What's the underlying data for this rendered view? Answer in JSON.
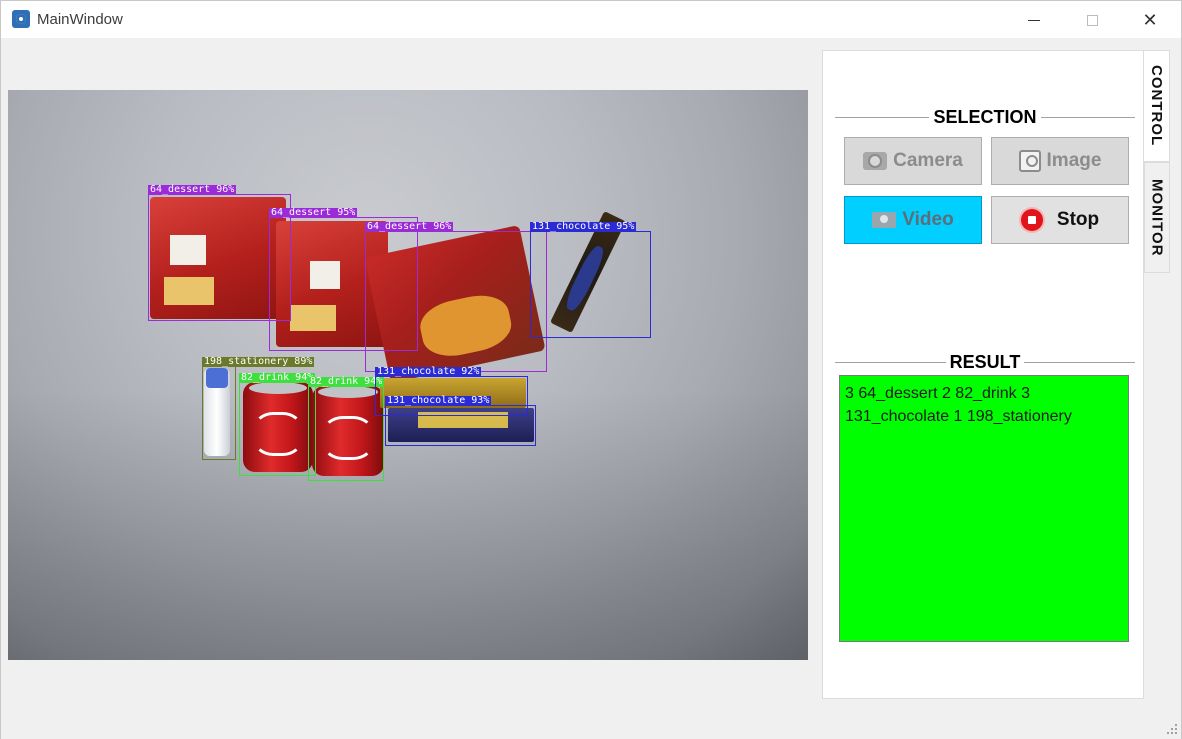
{
  "window": {
    "title": "MainWindow",
    "controls": [
      "minimize",
      "maximize",
      "close"
    ]
  },
  "display": {
    "detections": [
      {
        "label": "64_dessert 96%",
        "color": "#9b2bd6"
      },
      {
        "label": "64_dessert 95%",
        "color": "#9b2bd6"
      },
      {
        "label": "64_dessert 96%",
        "color": "#9b2bd6"
      },
      {
        "label": "131_chocolate 95%",
        "color": "#2b2bd6"
      },
      {
        "label": "198_stationery 89%",
        "color": "#6b7a2a"
      },
      {
        "label": "82_drink 94%",
        "color": "#3ee03e"
      },
      {
        "label": "82_drink 94%",
        "color": "#3ee03e"
      },
      {
        "label": "131_chocolate 92%",
        "color": "#2b2bd6"
      },
      {
        "label": "131_chocolate 93%",
        "color": "#2b2bd6"
      }
    ]
  },
  "tabs": [
    {
      "label": "CONTROL",
      "active": true
    },
    {
      "label": "MONITOR",
      "active": false
    }
  ],
  "selection": {
    "title": "SELECTION",
    "buttons": {
      "camera": {
        "label": "Camera",
        "icon": "camera-icon"
      },
      "image": {
        "label": "Image",
        "icon": "image-icon"
      },
      "video": {
        "label": "Video",
        "icon": "video-icon"
      },
      "stop": {
        "label": "Stop",
        "icon": "stop-icon"
      }
    }
  },
  "result": {
    "title": "RESULT",
    "lines": [
      "3 64_dessert 2 82_drink 3",
      "131_chocolate 1 198_stationery"
    ],
    "background": "#00ff00"
  }
}
